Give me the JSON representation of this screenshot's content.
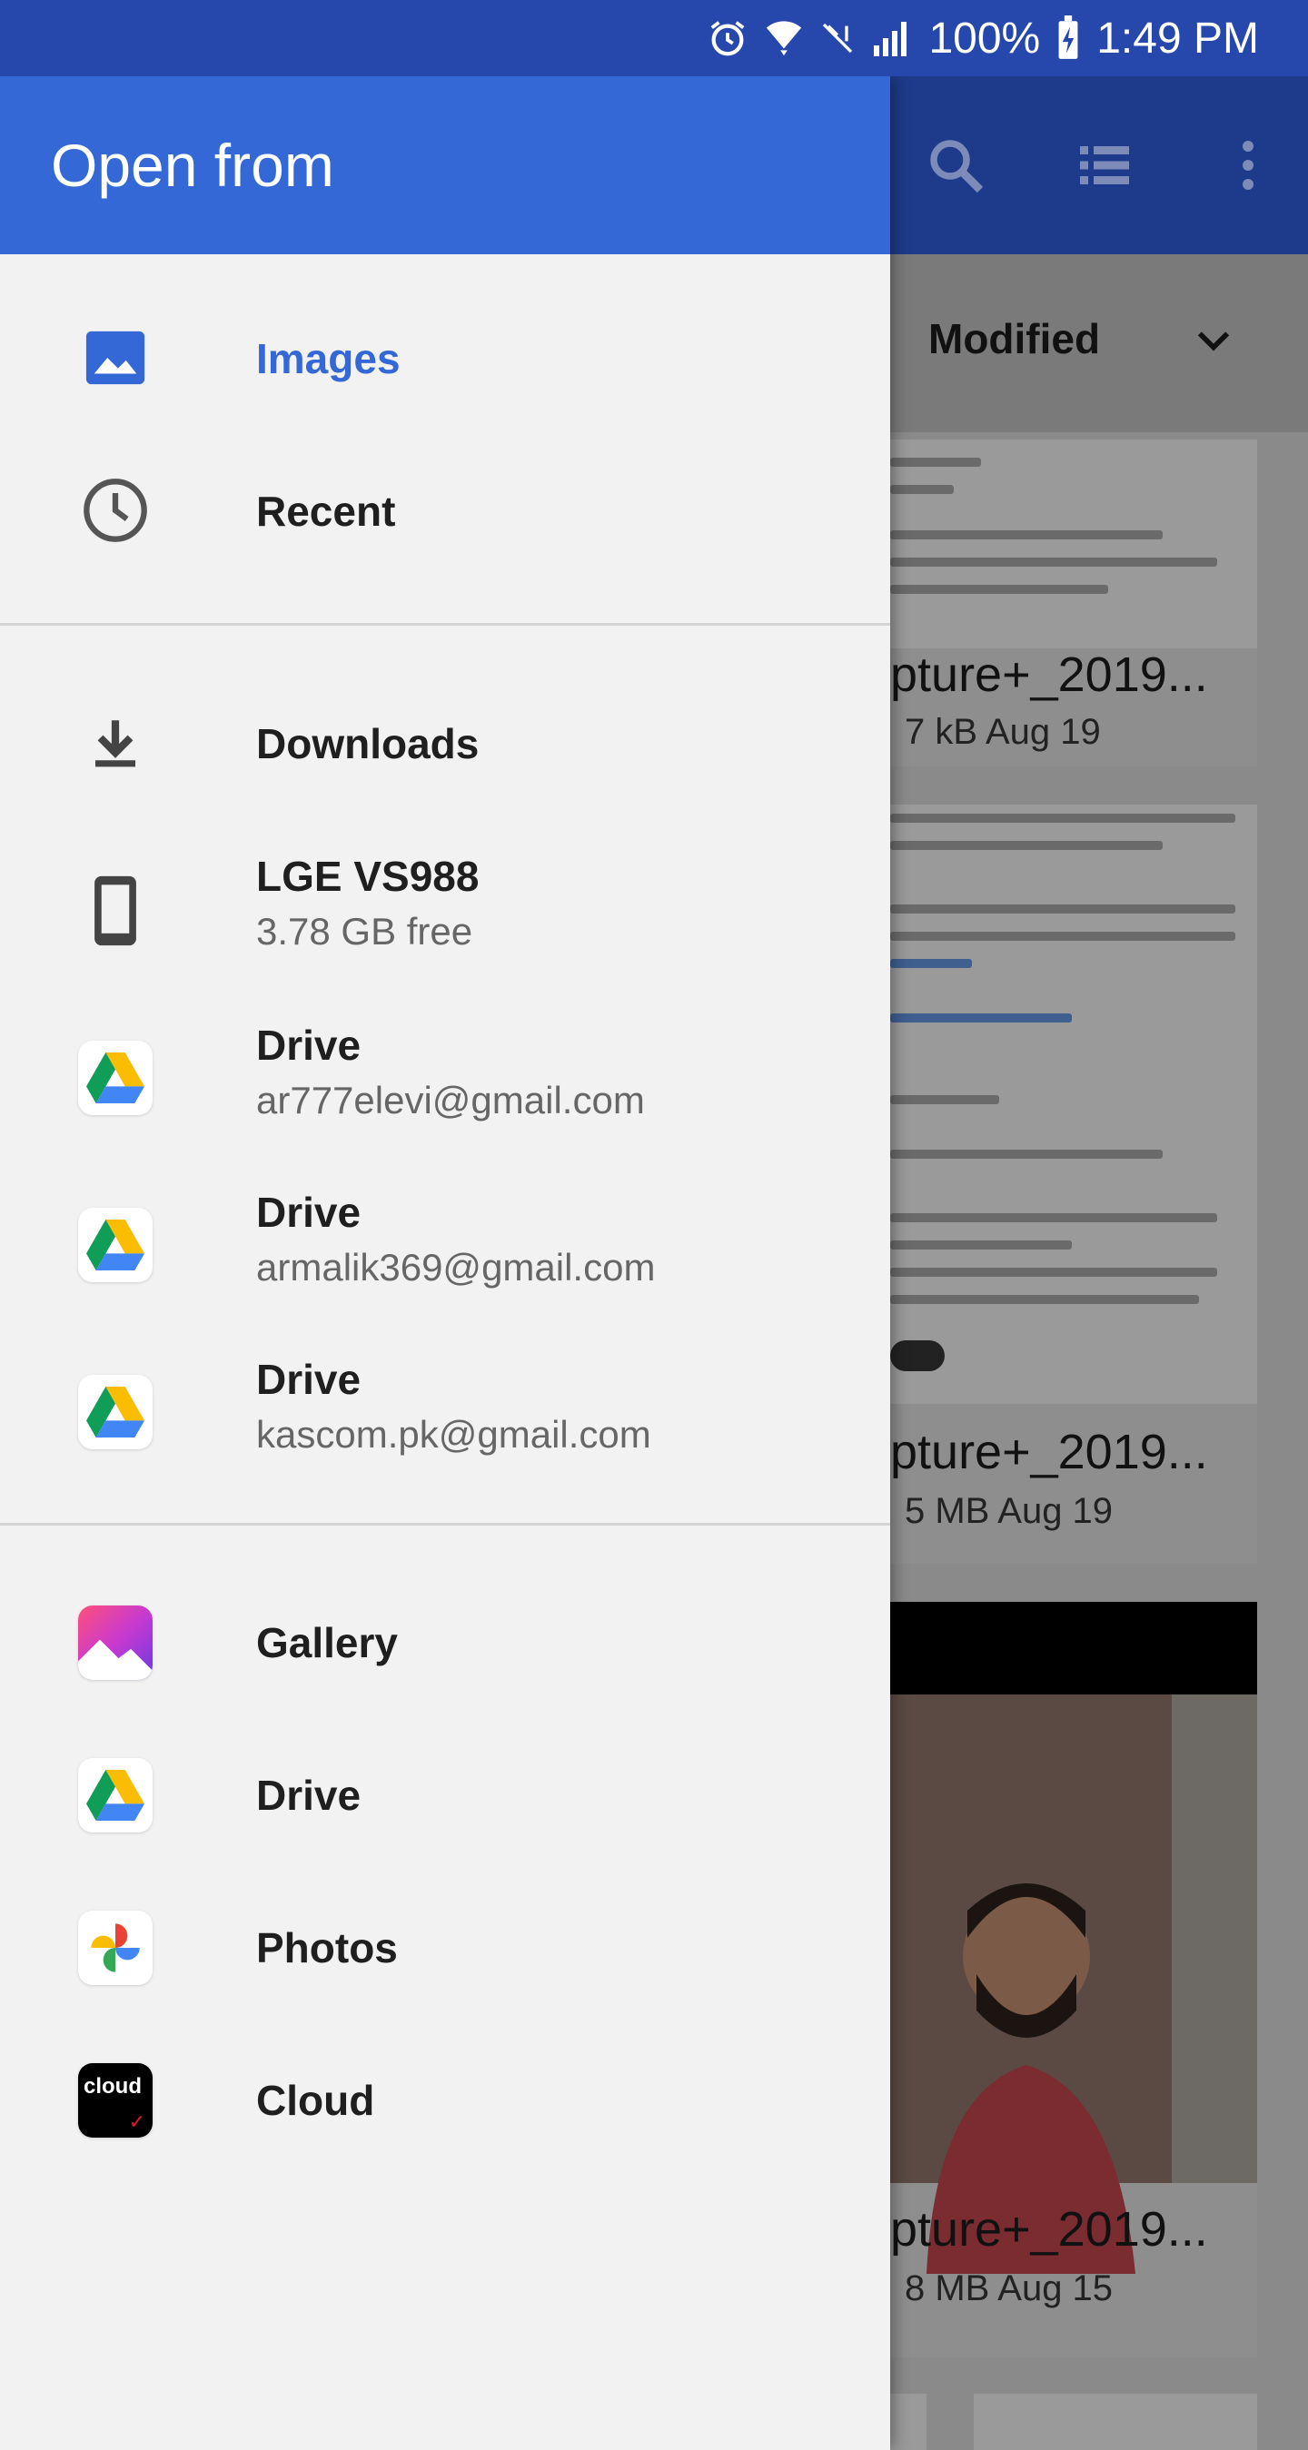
{
  "status_bar": {
    "battery": "100%",
    "time": "1:49 PM",
    "icons": [
      "alarm-icon",
      "wifi-icon",
      "no-signal-icon",
      "signal-icon",
      "battery-charging-icon"
    ]
  },
  "drawer": {
    "title": "Open from",
    "group1": [
      {
        "label": "Images",
        "icon": "image-icon",
        "selected": true
      },
      {
        "label": "Recent",
        "icon": "clock-icon"
      }
    ],
    "group2": [
      {
        "label": "Downloads",
        "icon": "download-icon"
      },
      {
        "label": "LGE VS988",
        "sub": "3.78 GB free",
        "icon": "phone-icon"
      },
      {
        "label": "Drive",
        "sub": "ar777elevi@gmail.com",
        "icon": "google-drive-icon"
      },
      {
        "label": "Drive",
        "sub": "armalik369@gmail.com",
        "icon": "google-drive-icon"
      },
      {
        "label": "Drive",
        "sub": "kascom.pk@gmail.com",
        "icon": "google-drive-icon"
      }
    ],
    "group3": [
      {
        "label": "Gallery",
        "icon": "gallery-icon"
      },
      {
        "label": "Drive",
        "icon": "google-drive-icon"
      },
      {
        "label": "Photos",
        "icon": "google-photos-icon"
      },
      {
        "label": "Cloud",
        "icon": "verizon-cloud-icon",
        "logo_text": "cloud"
      }
    ]
  },
  "background": {
    "toolbar_icons": [
      "search-icon",
      "list-view-icon",
      "more-vert-icon"
    ],
    "sort_label": "Modified",
    "cards": [
      {
        "title": "pture+_2019...",
        "meta": "7 kB  Aug 19"
      },
      {
        "title": "pture+_2019...",
        "meta": "5 MB  Aug 19"
      },
      {
        "title": "pture+_2019...",
        "meta": "8 MB  Aug 15"
      }
    ]
  }
}
